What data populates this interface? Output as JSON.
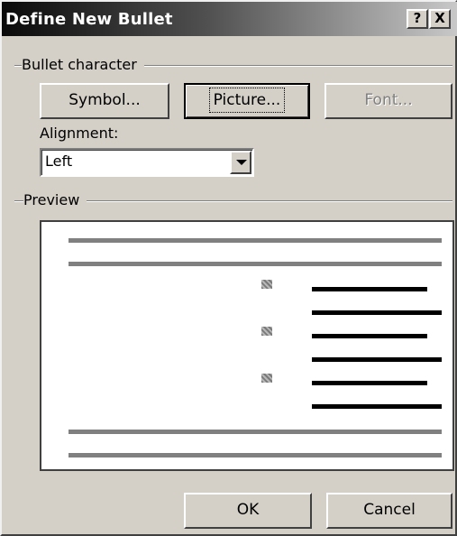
{
  "window": {
    "title": "Define New Bullet",
    "help_glyph": "?",
    "close_glyph": "X"
  },
  "bullet_character": {
    "group_label": "Bullet character",
    "symbol_label": "Symbol...",
    "picture_label": "Picture...",
    "font_label": "Font..."
  },
  "alignment": {
    "label": "Alignment:",
    "value": "Left"
  },
  "preview": {
    "group_label": "Preview"
  },
  "footer": {
    "ok_label": "OK",
    "cancel_label": "Cancel"
  }
}
